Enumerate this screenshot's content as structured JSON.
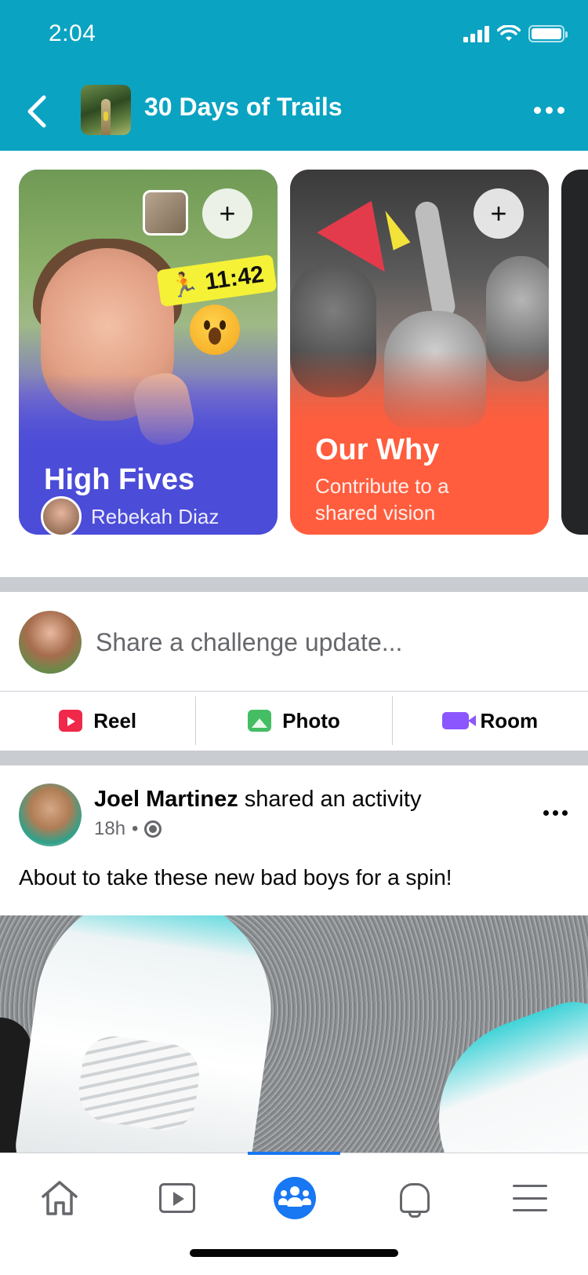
{
  "status_bar": {
    "time": "2:04"
  },
  "header": {
    "title": "30 Days of Trails"
  },
  "cards": [
    {
      "title": "High Fives",
      "author": "Rebekah Diaz",
      "sticker_timer": "11:42",
      "add_label": "+"
    },
    {
      "title": "Our Why",
      "subtitle": "Contribute to a shared vision",
      "add_label": "+"
    }
  ],
  "composer": {
    "placeholder": "Share a challenge update...",
    "actions": [
      {
        "label": "Reel",
        "icon": "reel-icon",
        "color": "#f02849"
      },
      {
        "label": "Photo",
        "icon": "photo-icon",
        "color": "#45bd62"
      },
      {
        "label": "Room",
        "icon": "room-icon",
        "color": "#8c56ff"
      }
    ]
  },
  "post": {
    "author": "Joel Martinez",
    "action_text": "shared an activity",
    "time": "18h",
    "separator": "•",
    "text": "About to take these new bad boys for a spin!"
  },
  "bottom_nav": {
    "items": [
      "home-icon",
      "video-icon",
      "groups-icon",
      "notifications-bell-icon",
      "menu-icon"
    ],
    "active": "groups-icon"
  },
  "colors": {
    "header": "#0aa3c2",
    "card_1": "#4b4cd8",
    "card_2": "#ff5d3d",
    "accent": "#1877f2"
  }
}
